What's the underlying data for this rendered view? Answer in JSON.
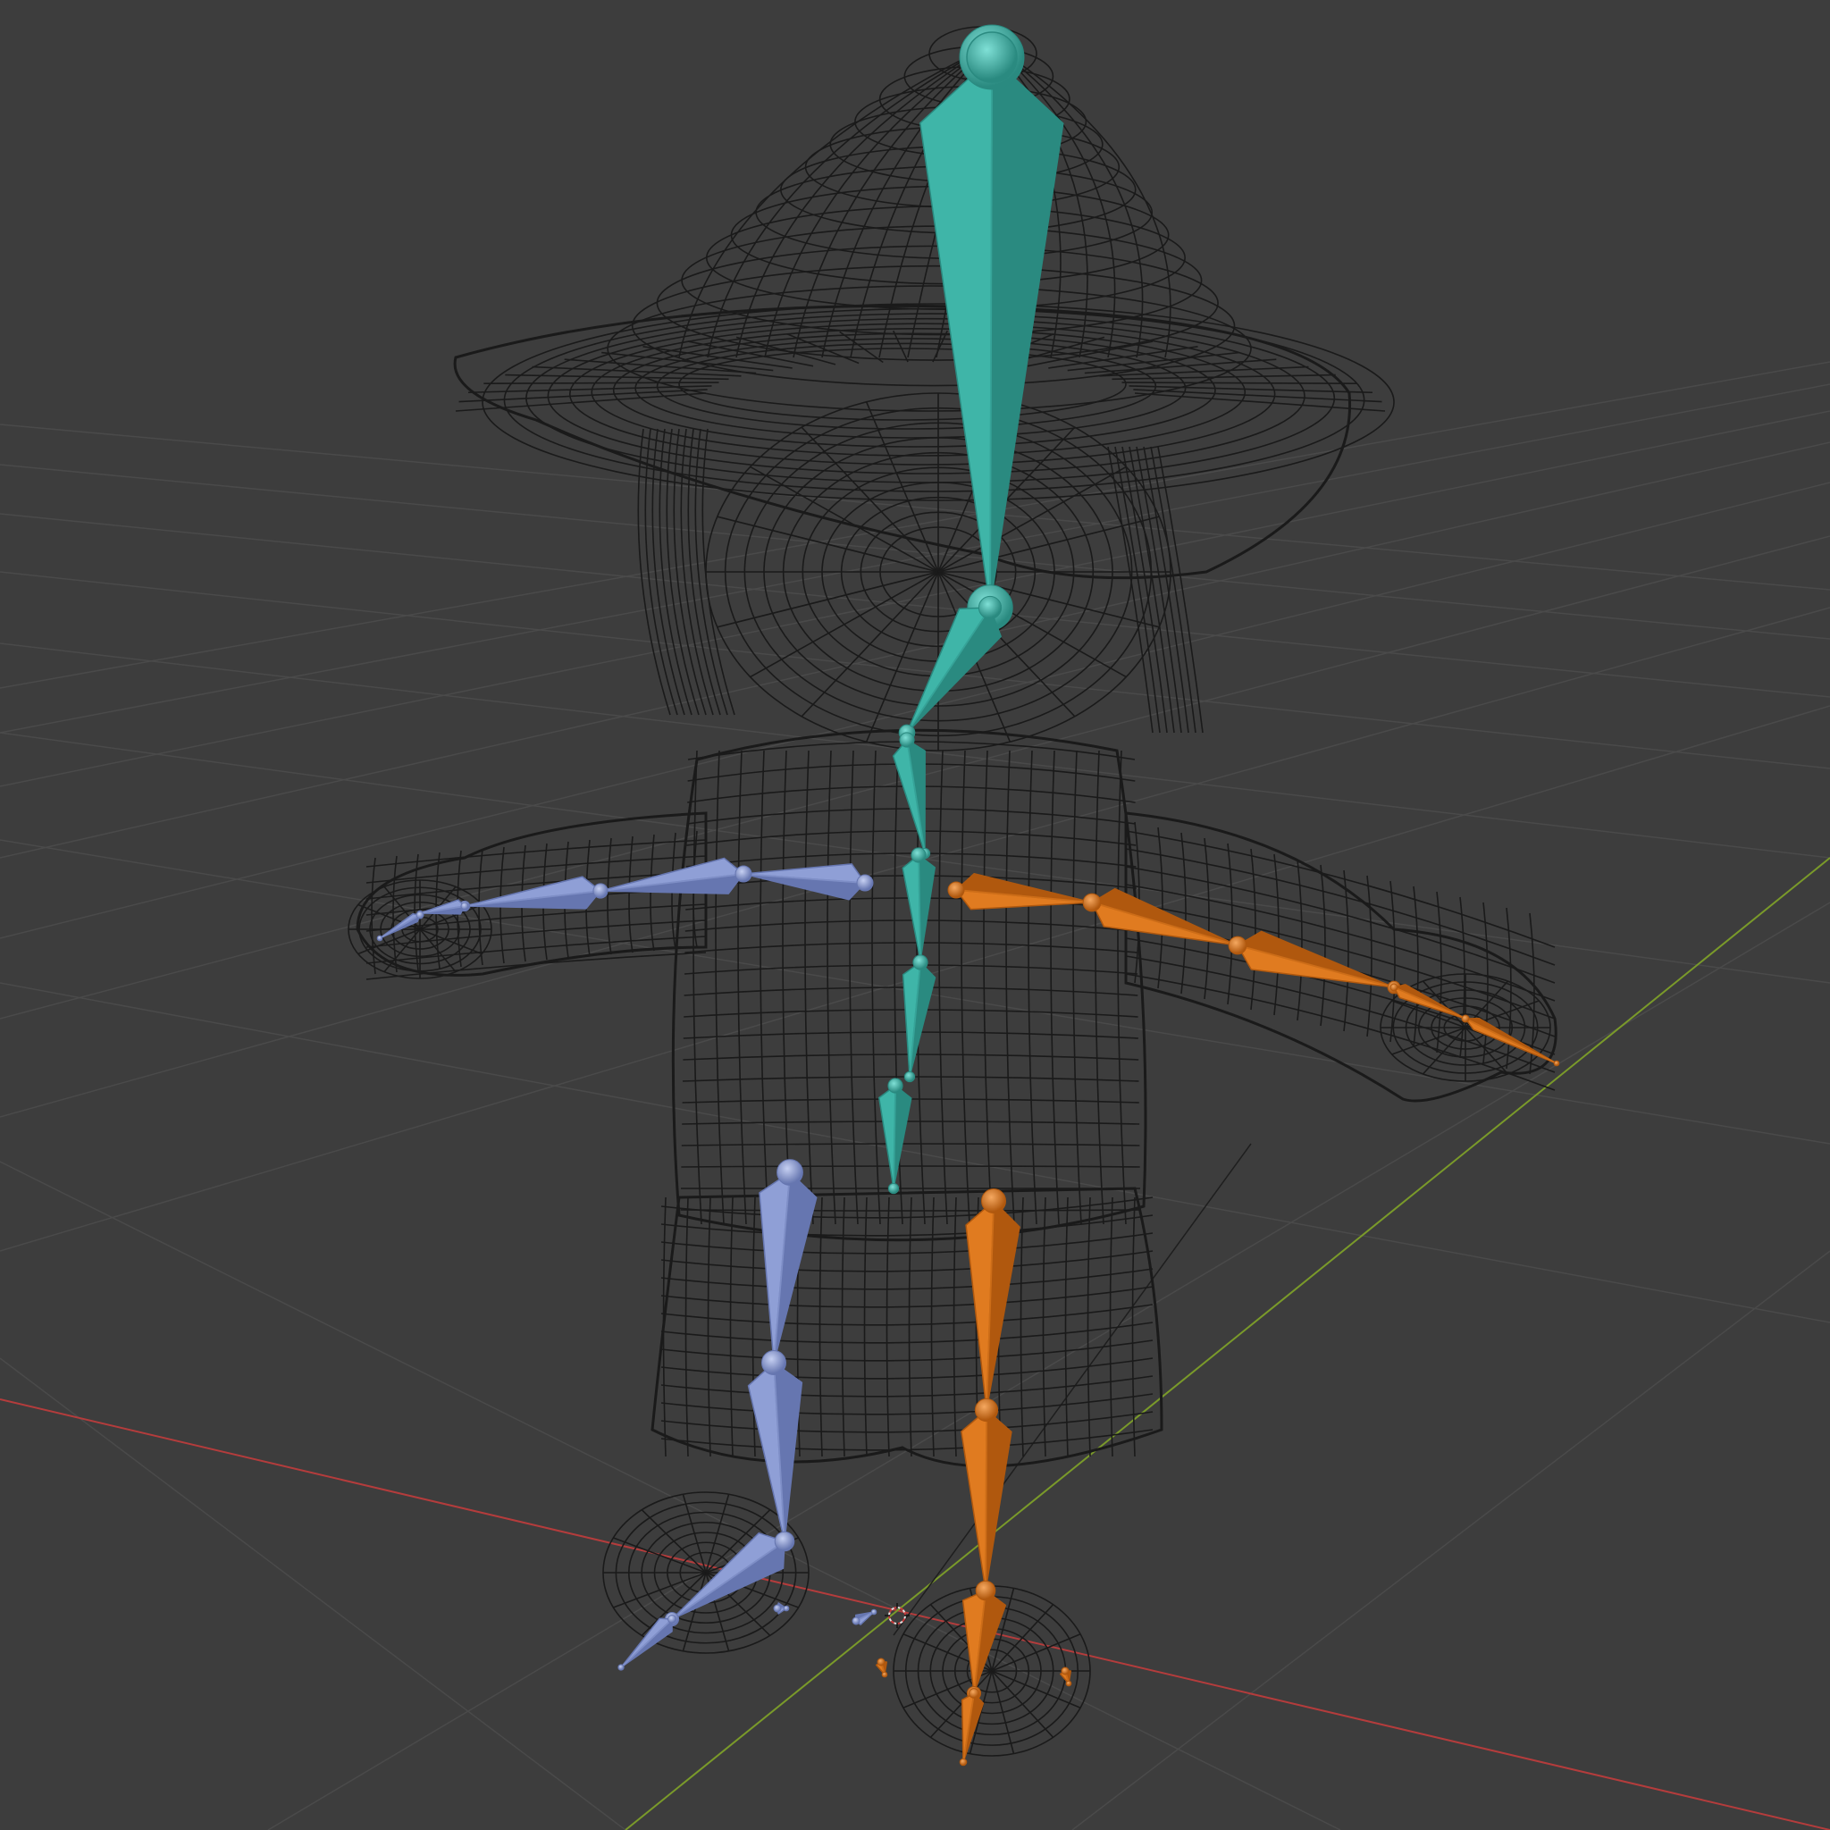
{
  "viewport": {
    "mode": "3d-viewport-wireframe-armature",
    "background_color": "#3d3d3d"
  },
  "colors": {
    "grid": "#4a4a4a",
    "grid_major": "#555555",
    "x_axis": "#b43c3c",
    "y_axis": "#7a9a2a",
    "wireframe": "#1a1a1a",
    "bone_center": "#3fb5a8",
    "bone_center_dark": "#2a8a80",
    "bone_left": "#8f9fd6",
    "bone_left_dark": "#6676b0",
    "bone_right": "#e07b20",
    "bone_right_dark": "#b0580e"
  },
  "scene": {
    "character": "wizard-hat-mesh",
    "armature": {
      "center_chain": [
        "head",
        "neck",
        "spine-upper",
        "spine-mid",
        "spine-low",
        "hips"
      ],
      "left_arm": [
        "hand-l",
        "forearm-l",
        "upper-arm-l",
        "shoulder-l"
      ],
      "right_arm": [
        "shoulder-r",
        "upper-arm-r",
        "forearm-r",
        "hand-r"
      ],
      "left_leg": [
        "thigh-l",
        "shin-l",
        "foot-l",
        "toe-l"
      ],
      "right_leg": [
        "thigh-r",
        "shin-r",
        "foot-r",
        "toe-r"
      ]
    },
    "icons": [
      "3d-cursor-icon"
    ]
  }
}
